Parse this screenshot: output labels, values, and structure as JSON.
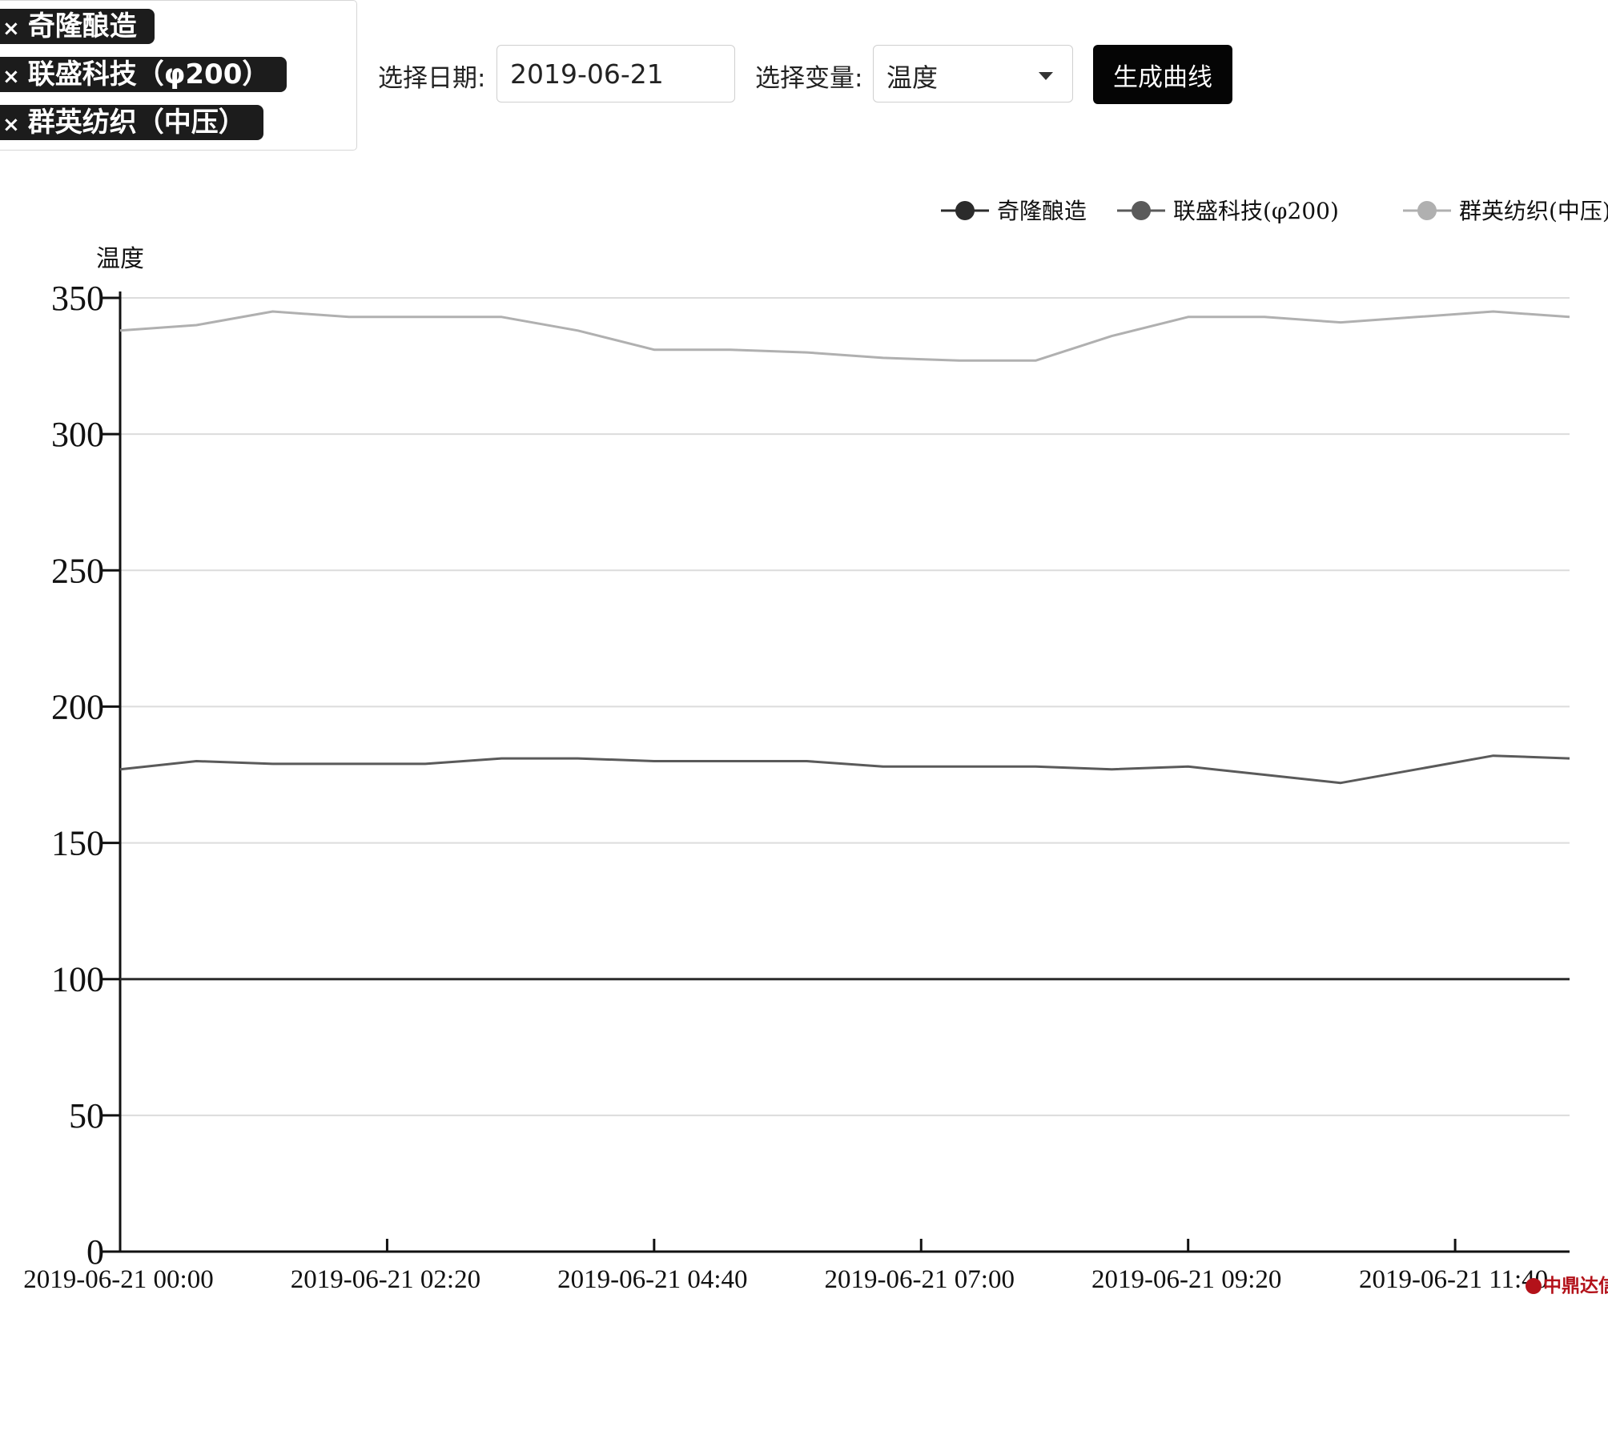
{
  "tags": [
    {
      "close": "×",
      "label": "奇隆酿造"
    },
    {
      "close": "×",
      "label": "联盛科技（φ200）"
    },
    {
      "close": "×",
      "label": "群英纺织（中压）"
    }
  ],
  "controls": {
    "date_label": "选择日期:",
    "date_value": "2019-06-21",
    "variable_label": "选择变量:",
    "variable_value": "温度",
    "generate_label": "生成曲线"
  },
  "watermark": "中鼎达信",
  "colors": {
    "series1": "#2b2b2b",
    "series2": "#5a5a5a",
    "series3": "#b0b0b0",
    "axis": "#111111",
    "grid": "#dcdcdc"
  },
  "chart_data": {
    "type": "line",
    "ylabel": "温度",
    "ylim": [
      0,
      350
    ],
    "yticks": [
      0,
      50,
      100,
      150,
      200,
      250,
      300,
      350
    ],
    "xticks": [
      "2019-06-21 00:00",
      "2019-06-21 02:20",
      "2019-06-21 04:40",
      "2019-06-21 07:00",
      "2019-06-21 09:20",
      "2019-06-21 11:40"
    ],
    "grid": true,
    "legend_position": "top-right",
    "x": [
      "2019-06-21 00:00",
      "2019-06-21 00:40",
      "2019-06-21 01:20",
      "2019-06-21 02:00",
      "2019-06-21 02:40",
      "2019-06-21 03:20",
      "2019-06-21 04:00",
      "2019-06-21 04:40",
      "2019-06-21 05:20",
      "2019-06-21 06:00",
      "2019-06-21 06:40",
      "2019-06-21 07:20",
      "2019-06-21 08:00",
      "2019-06-21 08:40",
      "2019-06-21 09:20",
      "2019-06-21 10:00",
      "2019-06-21 10:40",
      "2019-06-21 11:20",
      "2019-06-21 12:00",
      "2019-06-21 12:40"
    ],
    "series": [
      {
        "name": "奇隆酿造",
        "values": [
          100,
          100,
          100,
          100,
          100,
          100,
          100,
          100,
          100,
          100,
          100,
          100,
          100,
          100,
          100,
          100,
          100,
          100,
          100,
          100
        ]
      },
      {
        "name": "联盛科技(φ200)",
        "values": [
          177,
          180,
          179,
          179,
          179,
          181,
          181,
          180,
          180,
          180,
          178,
          178,
          178,
          177,
          178,
          175,
          172,
          177,
          182,
          181
        ]
      },
      {
        "name": "群英纺织(中压)",
        "values": [
          338,
          340,
          345,
          343,
          343,
          343,
          338,
          331,
          331,
          330,
          328,
          327,
          327,
          336,
          343,
          343,
          341,
          343,
          345,
          343
        ]
      }
    ]
  }
}
